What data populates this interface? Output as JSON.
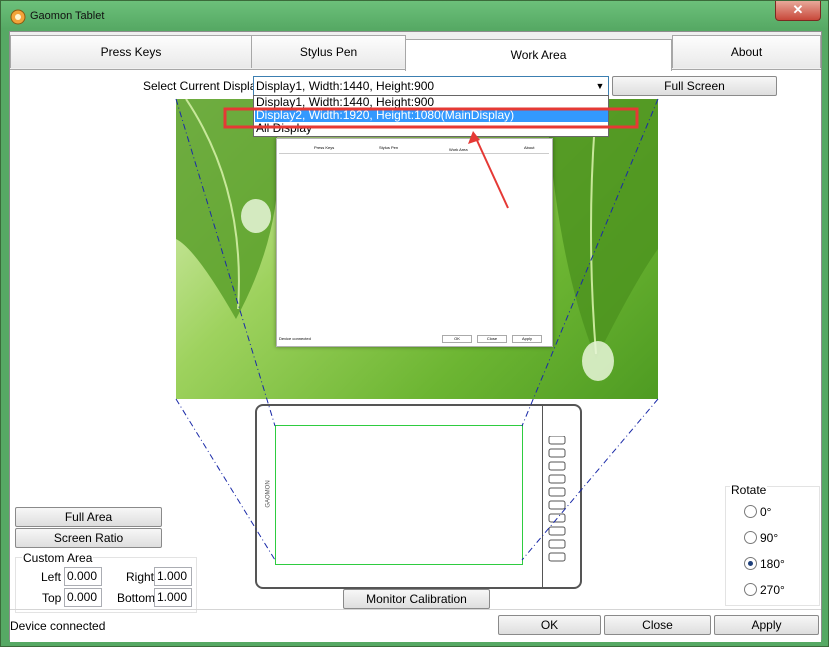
{
  "window": {
    "title": "Gaomon Tablet",
    "close_glyph": "✕"
  },
  "tabs": [
    {
      "label": "Press Keys"
    },
    {
      "label": "Stylus Pen"
    },
    {
      "label": "Work Area",
      "active": true
    },
    {
      "label": "About"
    }
  ],
  "display_select": {
    "label": "Select Current Display",
    "value": "Display1, Width:1440, Height:900",
    "options": [
      "Display1, Width:1440, Height:900",
      "Display2, Width:1920, Height:1080(MainDisplay)",
      "All Display"
    ]
  },
  "full_screen_label": "Full Screen",
  "preview_window": {
    "tabs": [
      "Press Keys",
      "Stylus Pen",
      "Work Area",
      "About"
    ],
    "status": "Device connected",
    "buttons": [
      "OK",
      "Close",
      "Apply"
    ]
  },
  "tablet": {
    "brand": "GAOMON"
  },
  "area_buttons": {
    "full_area": "Full Area",
    "screen_ratio": "Screen Ratio"
  },
  "custom_area": {
    "title": "Custom Area",
    "left_label": "Left",
    "left_value": "0.000",
    "right_label": "Right",
    "right_value": "1.000",
    "top_label": "Top",
    "top_value": "0.000",
    "bottom_label": "Bottom",
    "bottom_value": "1.000"
  },
  "monitor_calibration_label": "Monitor Calibration",
  "rotate": {
    "title": "Rotate",
    "options": [
      "0°",
      "90°",
      "180°",
      "270°"
    ],
    "selected": "180°"
  },
  "status_text": "Device connected",
  "footer_buttons": {
    "ok": "OK",
    "close": "Close",
    "apply": "Apply"
  },
  "colors": {
    "titlebar": "#56a964",
    "selection": "#3399ff",
    "highlight_box": "#e53935",
    "tablet_area": "#2ecc40",
    "projection_lines": "#1a2aa8"
  }
}
